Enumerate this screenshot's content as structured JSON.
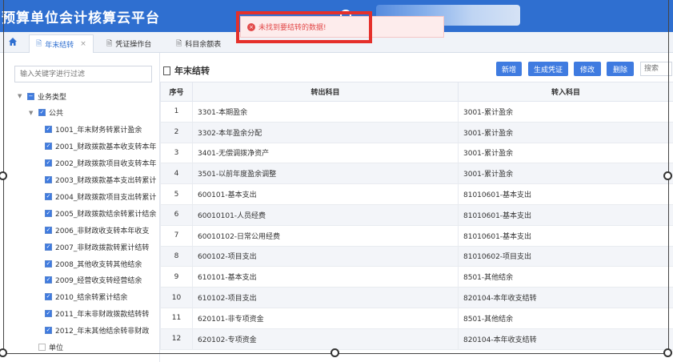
{
  "app": {
    "title": "预算单位会计核算云平台"
  },
  "tabs": [
    {
      "label": "年末结转",
      "active": true,
      "closable": true
    },
    {
      "label": "凭证操作台",
      "active": false,
      "closable": false
    },
    {
      "label": "科目余额表",
      "active": false,
      "closable": false
    }
  ],
  "toast": {
    "message": "未找到要结转的数据!",
    "type": "error"
  },
  "sidebar": {
    "filter_placeholder": "输入关键字进行过滤",
    "tree": [
      {
        "label": "业务类型",
        "level": 0,
        "state": "partial",
        "expanded": true
      },
      {
        "label": "公共",
        "level": 1,
        "state": "checked",
        "expanded": true
      },
      {
        "label": "1001_年末财务转累计盈余",
        "level": 2,
        "state": "checked"
      },
      {
        "label": "2001_财政拨款基本收支转本年",
        "level": 2,
        "state": "checked"
      },
      {
        "label": "2002_财政拨款项目收支转本年",
        "level": 2,
        "state": "checked"
      },
      {
        "label": "2003_财政拨款基本支出转累计",
        "level": 2,
        "state": "checked"
      },
      {
        "label": "2004_财政拨款项目支出转累计",
        "level": 2,
        "state": "checked"
      },
      {
        "label": "2005_财政拨款结余转累计结余",
        "level": 2,
        "state": "checked"
      },
      {
        "label": "2006_非财政收支转本年收支",
        "level": 2,
        "state": "checked"
      },
      {
        "label": "2007_非财政拨款转累计结转",
        "level": 2,
        "state": "checked"
      },
      {
        "label": "2008_其他收支转其他结余",
        "level": 2,
        "state": "checked"
      },
      {
        "label": "2009_经营收支转经营结余",
        "level": 2,
        "state": "checked"
      },
      {
        "label": "2010_结余转累计结余",
        "level": 2,
        "state": "checked"
      },
      {
        "label": "2011_年末非财政拨款结转转",
        "level": 2,
        "state": "checked"
      },
      {
        "label": "2012_年末其他结余转非财政",
        "level": 2,
        "state": "checked"
      },
      {
        "label": "单位",
        "level": 1,
        "state": "empty",
        "expanded": false
      }
    ]
  },
  "main": {
    "title": "年末结转",
    "buttons": {
      "add": "新增",
      "generate": "生成凭证",
      "edit": "修改",
      "delete": "删除"
    },
    "search_placeholder": "搜索",
    "columns": [
      "序号",
      "转出科目",
      "转入科目"
    ],
    "rows": [
      [
        "1",
        "3301-本期盈余",
        "3001-累计盈余"
      ],
      [
        "2",
        "3302-本年盈余分配",
        "3001-累计盈余"
      ],
      [
        "3",
        "3401-无偿调拨净资产",
        "3001-累计盈余"
      ],
      [
        "4",
        "3501-以前年度盈余调整",
        "3001-累计盈余"
      ],
      [
        "5",
        "600101-基本支出",
        "81010601-基本支出"
      ],
      [
        "6",
        "60010101-人员经费",
        "81010601-基本支出"
      ],
      [
        "7",
        "60010102-日常公用经费",
        "81010601-基本支出"
      ],
      [
        "8",
        "600102-项目支出",
        "81010602-项目支出"
      ],
      [
        "9",
        "610101-基本支出",
        "8501-其他结余"
      ],
      [
        "10",
        "610102-项目支出",
        "820104-本年收支结转"
      ],
      [
        "11",
        "620101-非专项资金",
        "8501-其他结余"
      ],
      [
        "12",
        "620102-专项资金",
        "820104-本年收支结转"
      ]
    ]
  },
  "colors": {
    "brand": "#2f6fd0",
    "button": "#3f7be0",
    "error": "#e24a4a",
    "highlight": "#e5302b"
  }
}
